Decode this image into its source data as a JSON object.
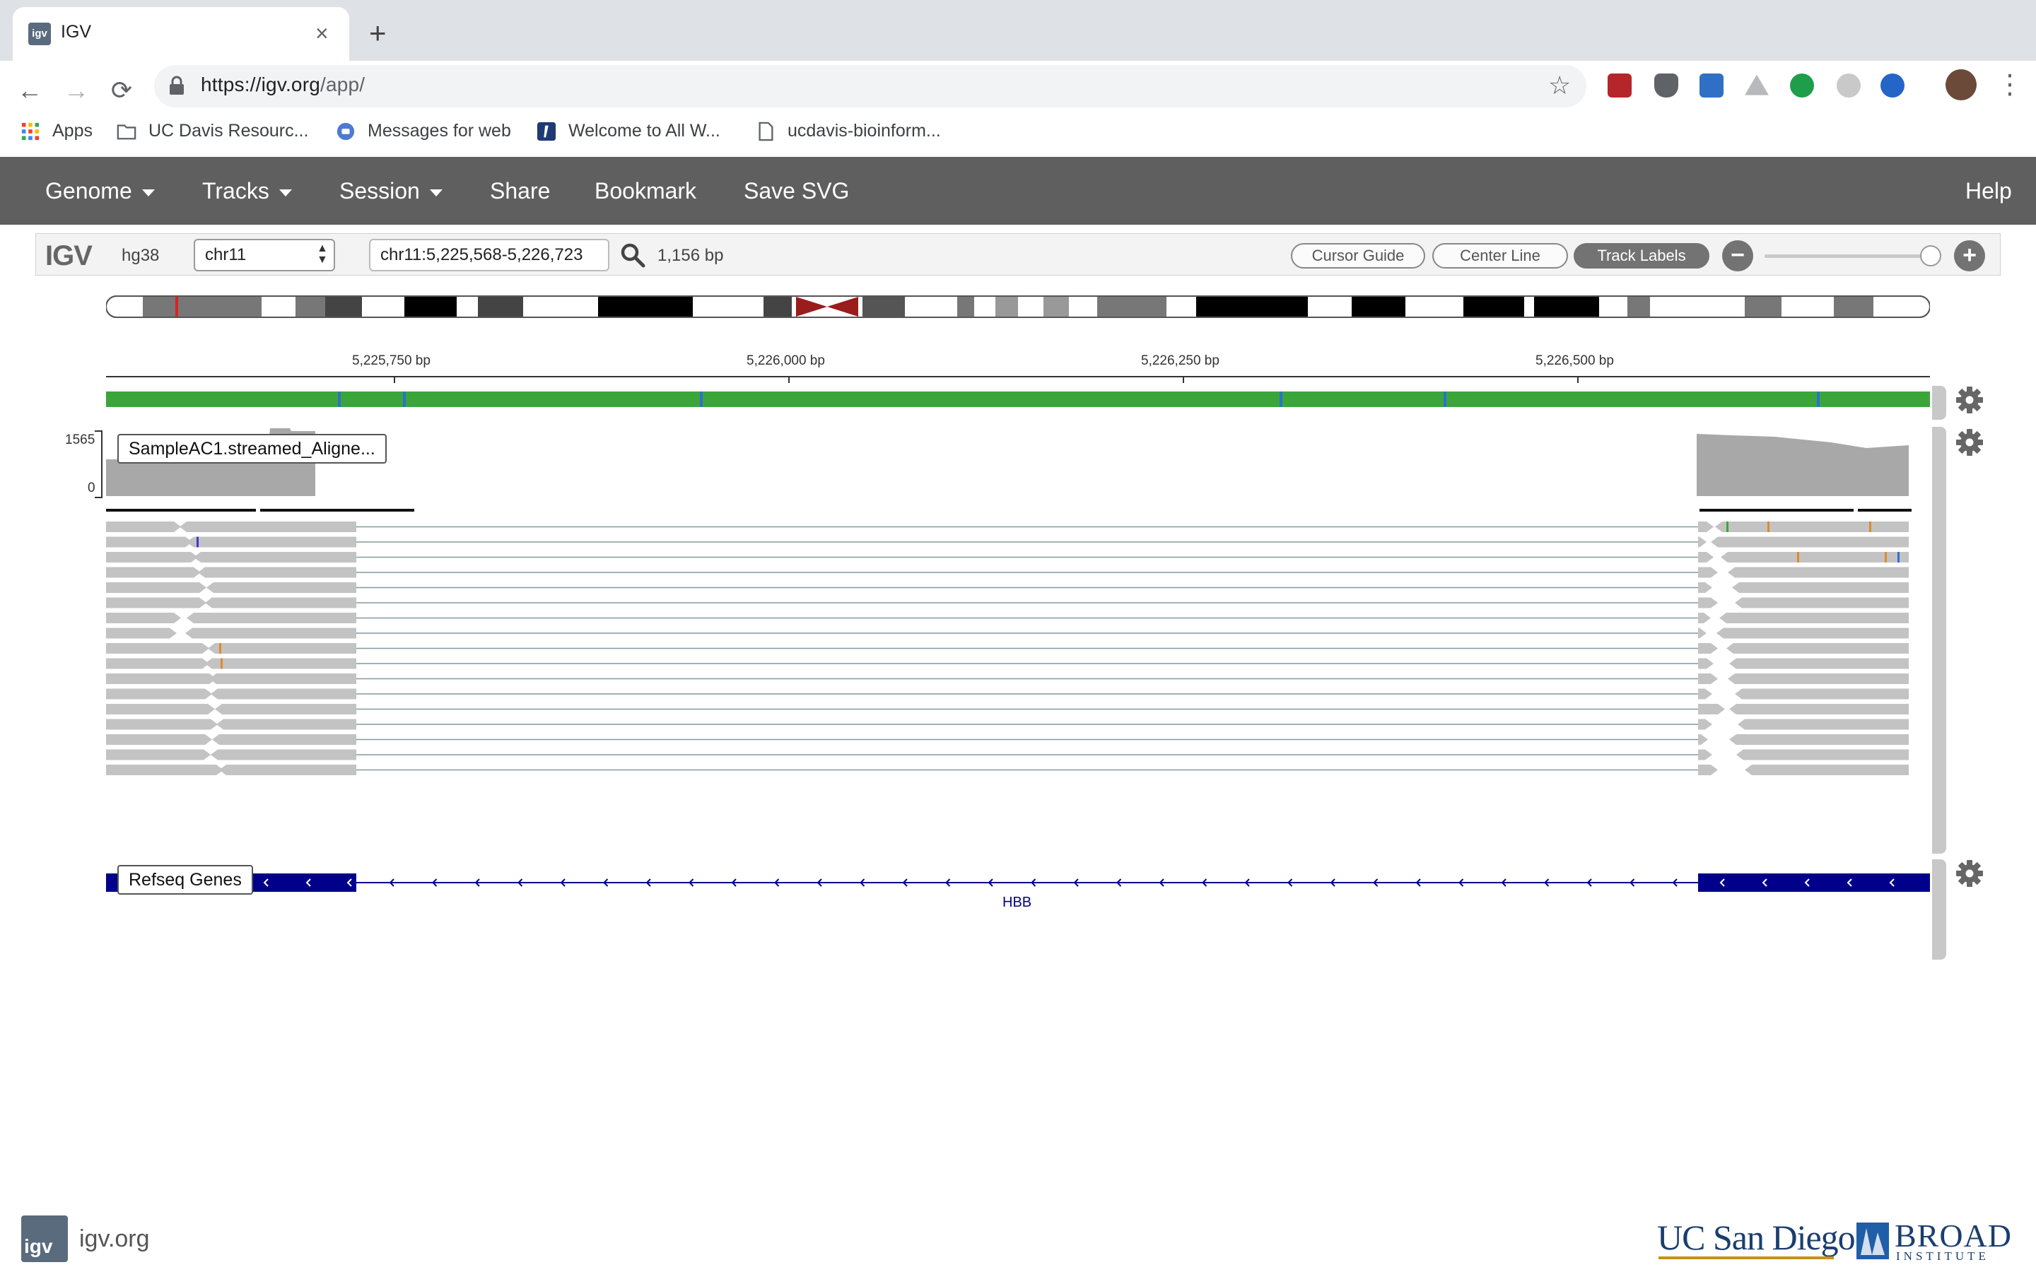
{
  "browser": {
    "tab_title": "IGV",
    "tab_favicon_text": "igv",
    "url_main": "https://igv.org",
    "url_path": "/app/",
    "bookmarks": [
      "Apps",
      "UC Davis Resourc...",
      "Messages for web",
      "Welcome to All W...",
      "ucdavis-bioinform..."
    ]
  },
  "igv_menu": {
    "genome": "Genome",
    "tracks": "Tracks",
    "session": "Session",
    "share": "Share",
    "bookmark": "Bookmark",
    "save_svg": "Save SVG",
    "help": "Help"
  },
  "controls": {
    "logo": "IGV",
    "genome": "hg38",
    "chromosome": "chr11",
    "locus": "chr11:5,225,568-5,226,723",
    "bp_width": "1,156 bp",
    "cursor_guide": "Cursor Guide",
    "center_line": "Center Line",
    "track_labels": "Track Labels",
    "zoom_level_fraction": 0.95
  },
  "ruler": {
    "labels": [
      "5,225,750 bp",
      "5,226,000 bp",
      "5,226,250 bp",
      "5,226,500 bp"
    ]
  },
  "tracks": {
    "alignment_name": "SampleAC1.streamed_Aligne...",
    "coverage_max": "1565",
    "coverage_min": "0",
    "gene_track_name": "Refseq Genes",
    "gene_name": "HBB"
  },
  "colors": {
    "nav_bg": "#5f5f5f",
    "read_gray": "#c3c3c3",
    "coverage_gray": "#a7a7a7",
    "gene_blue": "#00008b",
    "centromere_red": "#9b1c1c"
  },
  "footer": {
    "site": "igv.org",
    "logo_text": "igv",
    "ucsd": "UC San Diego",
    "broad": "BROAD",
    "broad_sub": "INSTITUTE"
  }
}
